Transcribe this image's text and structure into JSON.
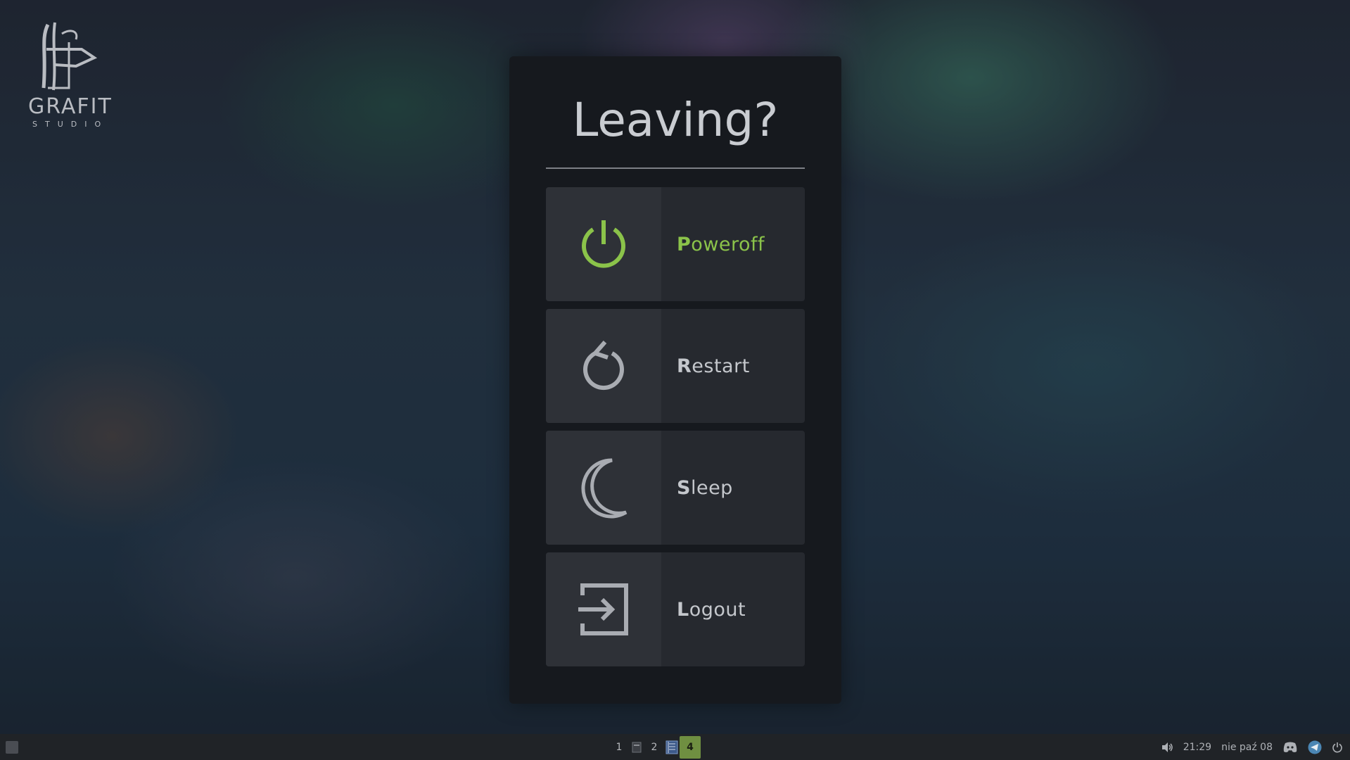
{
  "logo": {
    "name": "GRAFIT",
    "subtitle": "STUDIO"
  },
  "dialog": {
    "title": "Leaving?",
    "options": [
      {
        "mnemonic": "P",
        "rest": "oweroff",
        "icon": "power-icon",
        "active": true
      },
      {
        "mnemonic": "R",
        "rest": "estart",
        "icon": "restart-icon",
        "active": false
      },
      {
        "mnemonic": "S",
        "rest": "leep",
        "icon": "moon-icon",
        "active": false
      },
      {
        "mnemonic": "L",
        "rest": "ogout",
        "icon": "logout-icon",
        "active": false
      }
    ]
  },
  "taskbar": {
    "workspaces": [
      {
        "label": "1"
      },
      {
        "label": "2"
      },
      {
        "label": "4",
        "active": true
      }
    ],
    "time": "21:29",
    "date": "nie paź 08"
  },
  "colors": {
    "accent": "#8bc34a",
    "dialog_bg": "#16191e",
    "option_bg": "#26292f",
    "icon_bg": "#2e3137",
    "taskbar_bg": "#202327"
  }
}
